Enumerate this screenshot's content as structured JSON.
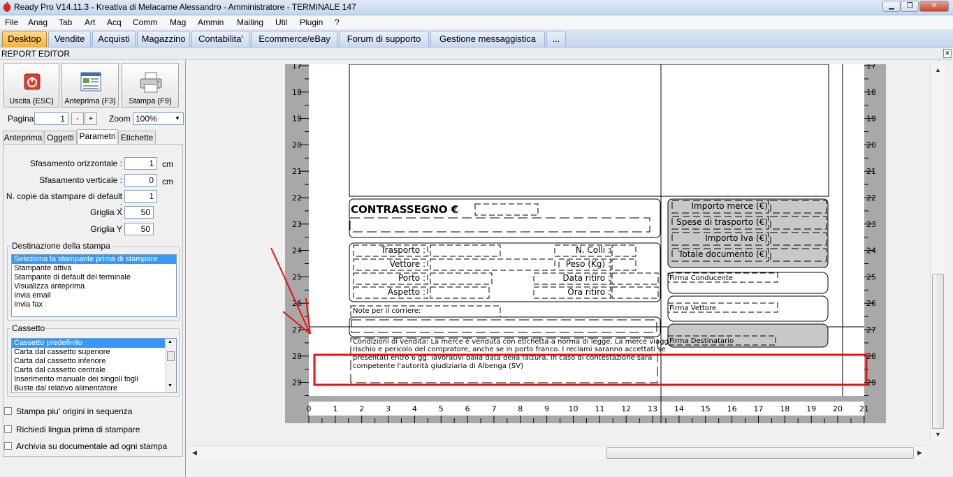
{
  "window": {
    "title": "Ready Pro V14.11.3 - Kreativa di Melacarne Alessandro - Amministratore - TERMINALE 147",
    "minimize": "▁",
    "maximize": "❐",
    "close": "✕"
  },
  "menu": [
    "File",
    "Anag",
    "Tab",
    "Art",
    "Acq",
    "Comm",
    "Mag",
    "Ammin",
    "Mailing",
    "Util",
    "Plugin",
    "?"
  ],
  "tabs": [
    "Desktop",
    "Vendite",
    "Acquisti",
    "Magazzino",
    "Contabilita'",
    "Ecommerce/eBay",
    "Forum di supporto",
    "Gestione messaggistica",
    "..."
  ],
  "editor": {
    "title": "REPORT EDITOR",
    "close": "✕"
  },
  "toolbar": {
    "exit_label": "Uscita (ESC)",
    "preview_label": "Anteprima (F3)",
    "print_label": "Stampa (F9)",
    "page_label": "Pagina",
    "page_value": "1",
    "prev": "-",
    "next": "+",
    "zoom_label": "Zoom",
    "zoom_value": "100%"
  },
  "subtabs": [
    "Anteprima",
    "Oggetti",
    "Parametri",
    "Etichette"
  ],
  "params": {
    "offset_h_label": "Sfasamento orizzontale :",
    "offset_h": "1",
    "offset_h_unit": "cm",
    "offset_v_label": "Sfasamento verticale :",
    "offset_v": "0",
    "offset_v_unit": "cm",
    "copies_label": "N. copie da stampare di default :",
    "copies": "1",
    "grid_x_label": "Griglia X",
    "grid_x": "50",
    "grid_y_label": "Griglia Y",
    "grid_y": "50"
  },
  "destination": {
    "title": "Destinazione della stampa",
    "items": [
      "Seleziona la stampante prima di stampare",
      "Stampante attiva",
      "Stampante di default del terminale",
      "Visualizza anteprima",
      "Invia email",
      "Invia fax"
    ]
  },
  "drawer": {
    "title": "Cassetto",
    "items": [
      "Cassetto predefinito",
      "Carta dal cassetto superiore",
      "Carta dal cassetto inferiore",
      "Carta dal cassetto centrale",
      "Inserimento manuale dei singoli fogli",
      "Buste dal relativo alimentatore"
    ]
  },
  "checks": [
    "Stampa piu' origini in sequenza",
    "Richiedi lingua prima di stampare",
    "Archivia su documentale ad ogni stampa"
  ],
  "report": {
    "contrassegno": "CONTRASSEGNO €",
    "trasporto": "Trasporto :",
    "vettore": "Vettore :",
    "porto": "Porto :",
    "aspetto": "Aspetto :",
    "colli": "N. Colli :",
    "peso": "Peso (Kg) :",
    "data_ritiro": "Data ritiro :",
    "ora_ritiro": "Ora ritiro :",
    "note": "Note  per il corriere:",
    "conditions": [
      "Condizioni di vendita: La merce è venduta con etichetta a norma di legge. La merce viaggia a",
      "rischio e pericolo del compratore, anche se in porto franco. I reclami saranno accettati se",
      "presentati entro 6 gg. lavorativi dalla data della fattura. In caso di contestazione sarà",
      "competente l'autorità giudiziaria di Albenga (SV)"
    ],
    "importo_merce": "Importo merce (€)",
    "spese_trasporto": "Spese di trasporto (€)",
    "importo_iva": "Importo Iva (€)",
    "totale": "Totale documento (€)",
    "firma_conducente": "Firma Conducente",
    "firma_vettore": "Firma Vettore",
    "firma_destinatario": "Firma Destinatario"
  },
  "ruler": {
    "v_labels": [
      "17",
      "18",
      "19",
      "20",
      "21",
      "22",
      "23",
      "24",
      "25",
      "26",
      "27",
      "28",
      "29"
    ],
    "h_labels": [
      "0",
      "1",
      "2",
      "3",
      "4",
      "5",
      "6",
      "7",
      "8",
      "9",
      "10",
      "11",
      "12",
      "13",
      "14",
      "15",
      "16",
      "17",
      "18",
      "19",
      "20",
      "21"
    ]
  },
  "colors": {
    "highlight": "#e81010",
    "arrow": "#e81010",
    "selection": "#3399ff",
    "active_tab": "#f5b53f"
  }
}
